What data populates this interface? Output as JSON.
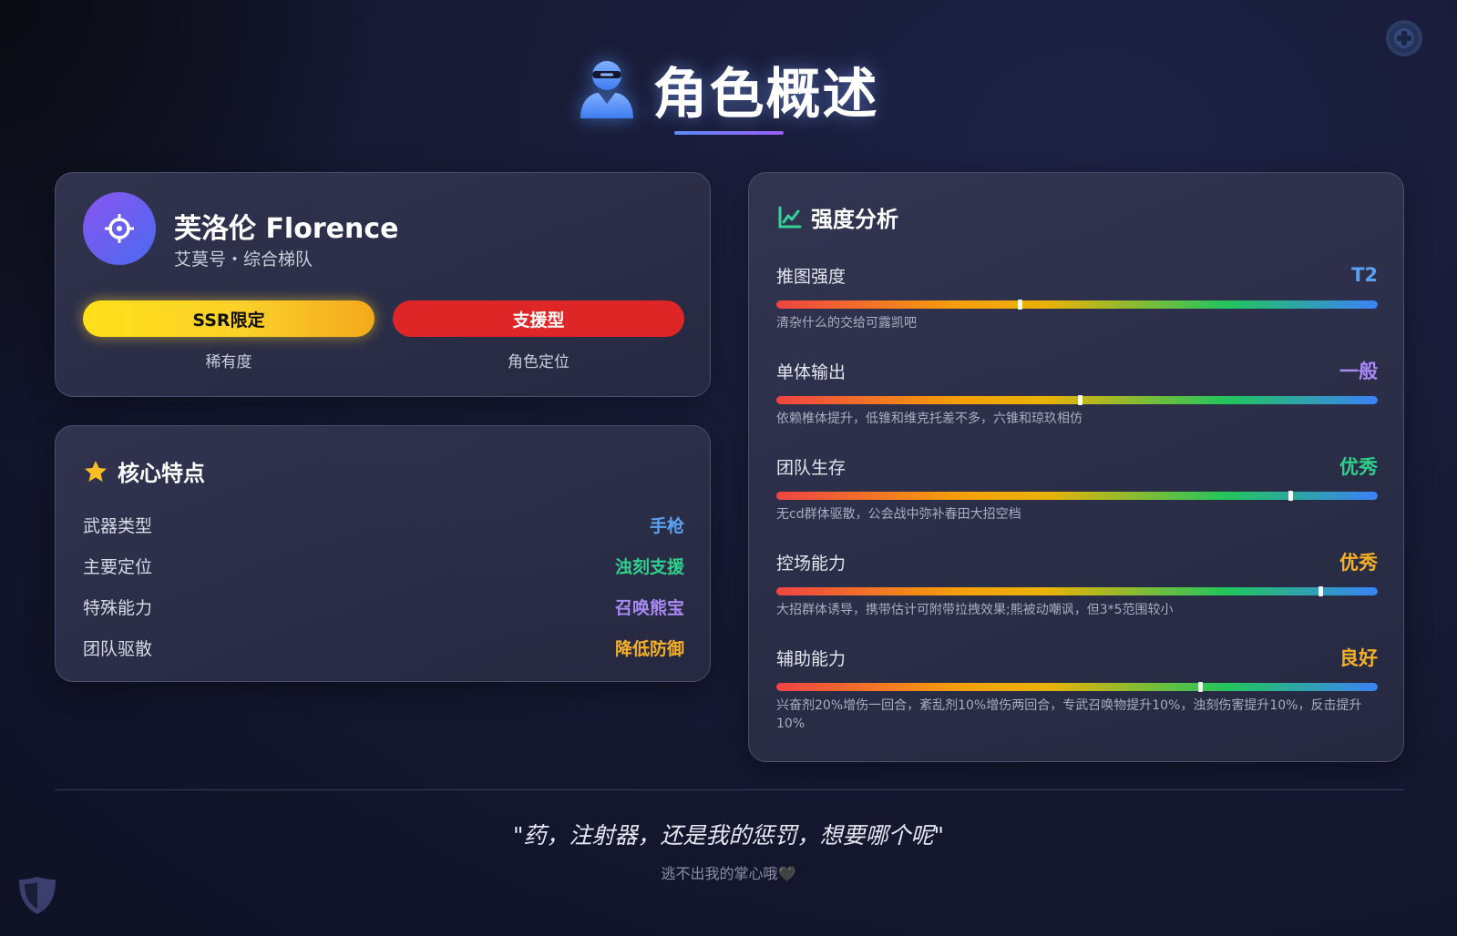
{
  "header": {
    "title": "角色概述",
    "icon": "user-ninja-icon"
  },
  "profile": {
    "name": "芙洛伦 Florence",
    "subtitle": "艾莫号・综合梯队",
    "avatar_icon": "crosshair-icon",
    "rarity_value": "SSR限定",
    "rarity_label": "稀有度",
    "role_value": "支援型",
    "role_label": "角色定位"
  },
  "core": {
    "title": "核心特点",
    "icon": "star-icon",
    "rows": [
      {
        "key": "武器类型",
        "value": "手枪",
        "color": "#5aa2f5"
      },
      {
        "key": "主要定位",
        "value": "浊刻支援",
        "color": "#2fcf8c"
      },
      {
        "key": "特殊能力",
        "value": "召唤熊宝",
        "color": "#a888f5"
      },
      {
        "key": "团队驱散",
        "value": "降低防御",
        "color": "#f5b025"
      }
    ]
  },
  "strength": {
    "title": "强度分析",
    "icon": "chart-line-icon",
    "stats": [
      {
        "name": "推图强度",
        "grade": "T2",
        "grade_color": "#5aa2f5",
        "level": 0.405,
        "note": "清杂什么的交给可露凯吧"
      },
      {
        "name": "单体输出",
        "grade": "一般",
        "grade_color": "#a888f5",
        "level": 0.505,
        "note": "依赖椎体提升，低锥和维克托差不多，六锥和琼玖相仿"
      },
      {
        "name": "团队生存",
        "grade": "优秀",
        "grade_color": "#2fcf8c",
        "level": 0.855,
        "note": "无cd群体驱散，公会战中弥补春田大招空档"
      },
      {
        "name": "控场能力",
        "grade": "优秀",
        "grade_color": "#f5b025",
        "level": 0.905,
        "note": "大招群体诱导，携带估计可附带拉拽效果;熊被动嘲讽，但3*5范围较小"
      },
      {
        "name": "辅助能力",
        "grade": "良好",
        "grade_color": "#f5b025",
        "level": 0.705,
        "note": "兴奋剂20%增伤一回合，紊乱剂10%增伤两回合，专武召唤物提升10%，浊刻伤害提升10%，反击提升10%"
      }
    ]
  },
  "footer": {
    "quote": "\"药，注射器，还是我的惩罚，想要哪个呢\"",
    "sub": "逃不出我的掌心哦🖤"
  }
}
